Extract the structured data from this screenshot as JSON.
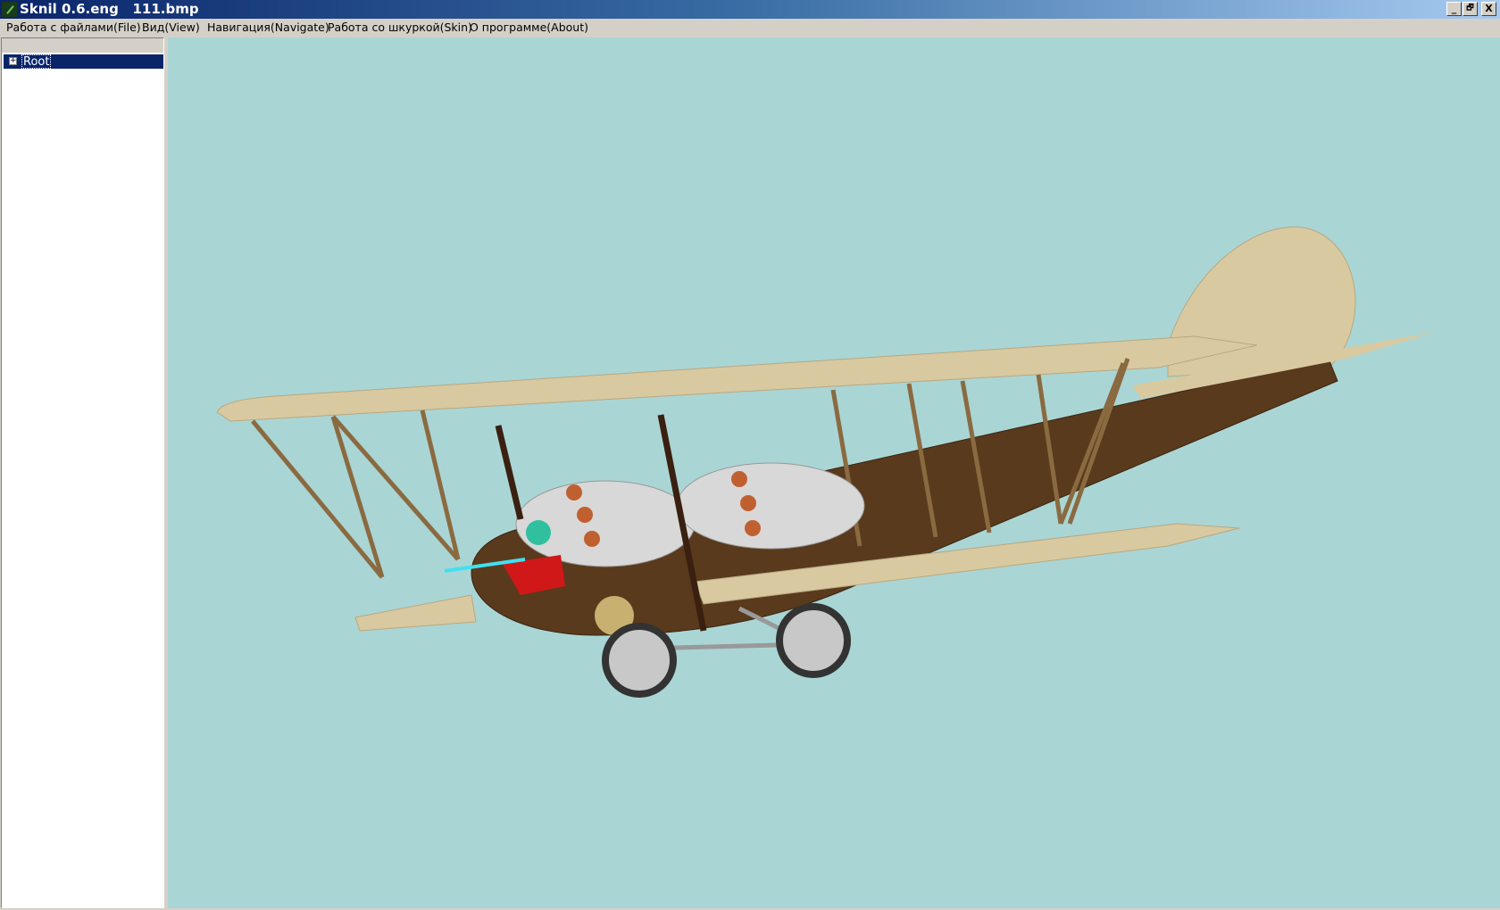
{
  "window": {
    "title": "Sknil 0.6.eng   111.bmp",
    "controls": {
      "minimize": "_",
      "restore": "🗗",
      "close": "X"
    }
  },
  "menu": [
    "Работа с файлами(File)",
    "Вид(View)",
    "Навигация(Navigate)",
    "Работа со шкуркой(Skin)",
    "О программе(About)"
  ],
  "tree": {
    "expander": "+",
    "root_label": "Root"
  },
  "viewport": {
    "background": "#aad5d5",
    "model": "biplane"
  }
}
